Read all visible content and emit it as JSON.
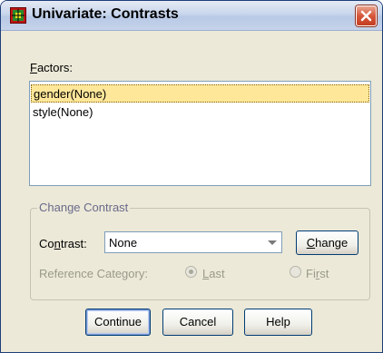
{
  "window": {
    "title": "Univariate: Contrasts"
  },
  "factors": {
    "label": "Factors:",
    "label_accel": "F",
    "label_rest": "actors:",
    "items": [
      {
        "label": "gender(None)",
        "selected": true
      },
      {
        "label": "style(None)",
        "selected": false
      }
    ]
  },
  "change_contrast": {
    "legend": "Change Contrast",
    "contrast_label_pre": "Co",
    "contrast_label_accel": "n",
    "contrast_label_post": "trast:",
    "contrast_value": "None",
    "change_button_pre": "",
    "change_button_accel": "C",
    "change_button_post": "hange",
    "reference_label": "Reference Category:",
    "last_accel": "L",
    "last_rest": "ast",
    "last_selected": true,
    "first_pre": "Fi",
    "first_accel": "r",
    "first_post": "st",
    "first_selected": false
  },
  "buttons": {
    "continue": "Continue",
    "cancel": "Cancel",
    "help": "Help"
  },
  "colors": {
    "selected_item": "#ffe79a",
    "close_button": "#d6573b"
  }
}
